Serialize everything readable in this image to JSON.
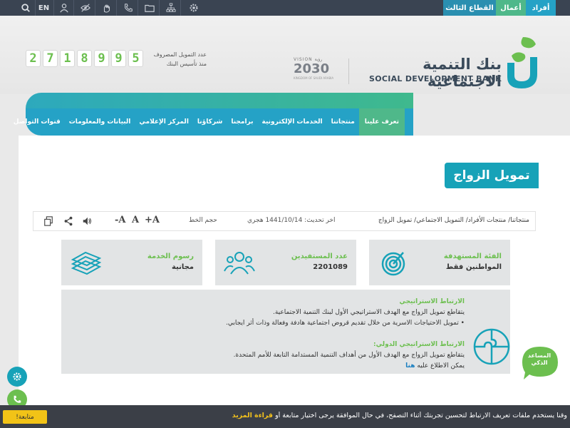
{
  "topbar": {
    "en_label": "EN",
    "tabs": [
      {
        "label": "أفراد",
        "color": "#25a2c6"
      },
      {
        "label": "أعمال",
        "color": "#4fb88a"
      },
      {
        "label": "القطاع الثالث",
        "color": "#2a8fb0"
      }
    ],
    "icons": [
      "search-icon",
      "language-toggle",
      "user-icon",
      "eye-off-icon",
      "sign-language-icon",
      "phone-icon",
      "folder-icon",
      "sitemap-icon",
      "settings-icon"
    ]
  },
  "header": {
    "counter_label_line1": "عدد التمويل المصروف",
    "counter_label_line2": "منذ تأسيس البنك",
    "digits": [
      "5",
      "9",
      "9",
      "8",
      "1",
      "7",
      "2"
    ],
    "vision_top": "VISION رؤية",
    "vision_year": "2030",
    "vision_sub": "KINGDOM OF SAUDI ARABIA",
    "bank_name_ar": "بنك التنمية الاجتماعية",
    "bank_name_en": "SOCIAL DEVELOPMENT BANK"
  },
  "nav": {
    "items": [
      "تعرف علينا",
      "منتجاتنا",
      "الخدمات الإلكترونية",
      "برامجنا",
      "شركاؤنا",
      "المركز الإعلامي",
      "البيانات والمعلومات",
      "قنوات التواصل"
    ]
  },
  "page": {
    "title": "تمويل الزواج",
    "breadcrumb": "منتجاتنا/ منتجات الأفراد/ التمويل الاجتماعي/ تمويل الزواج",
    "updated": "اخر تحديث: 1441/10/14 هجري",
    "font_size_label": "حجم الخط",
    "font_buttons": [
      "+A",
      "A",
      "-A"
    ]
  },
  "cards": [
    {
      "title": "الفئة المستهدفة",
      "value": "المواطنين فقط",
      "icon": "target-icon"
    },
    {
      "title": "عدد المستفيدين",
      "value": "2201089",
      "icon": "users-icon"
    },
    {
      "title": "رسوم الخدمة",
      "value": "مجانية",
      "icon": "money-icon"
    }
  ],
  "info": {
    "heading1": "الارتباط الاستراتيجي",
    "line1": "يتقاطع تمويل الزواج مع الهدف الاستراتيجي الأول لبنك التنمية الاجتماعية.",
    "line2": "• تمويل الاحتياجات الاسرية من خلال تقديم قروض اجتماعية هادفة وفعالة وذات أثر ايجابي.",
    "heading2": "الارتباط الاستراتيجي الدولي:",
    "line3": "يتقاطع تمويل الزواج مع الهدف الأول من أهداف التنمية المستدامة التابعة للأمم المتحدة.",
    "line4_prefix": "يمكن الاطلاع عليه",
    "line4_link": "هنا"
  },
  "assistant": {
    "line1": "المساعد",
    "line2": "الذكي"
  },
  "cookie": {
    "text": "وقنا يستخدم ملفات تعريف الارتباط لتحسين تجربتك أثناء التصفح، في حال الموافقة يرجى اختيار متابعة أو",
    "link": "قراءة المزيد",
    "button": "متابعة!"
  },
  "colors": {
    "teal": "#17a2b8",
    "green": "#6cbf4f",
    "nav": "#25a2c6",
    "dark": "#3a4452"
  }
}
